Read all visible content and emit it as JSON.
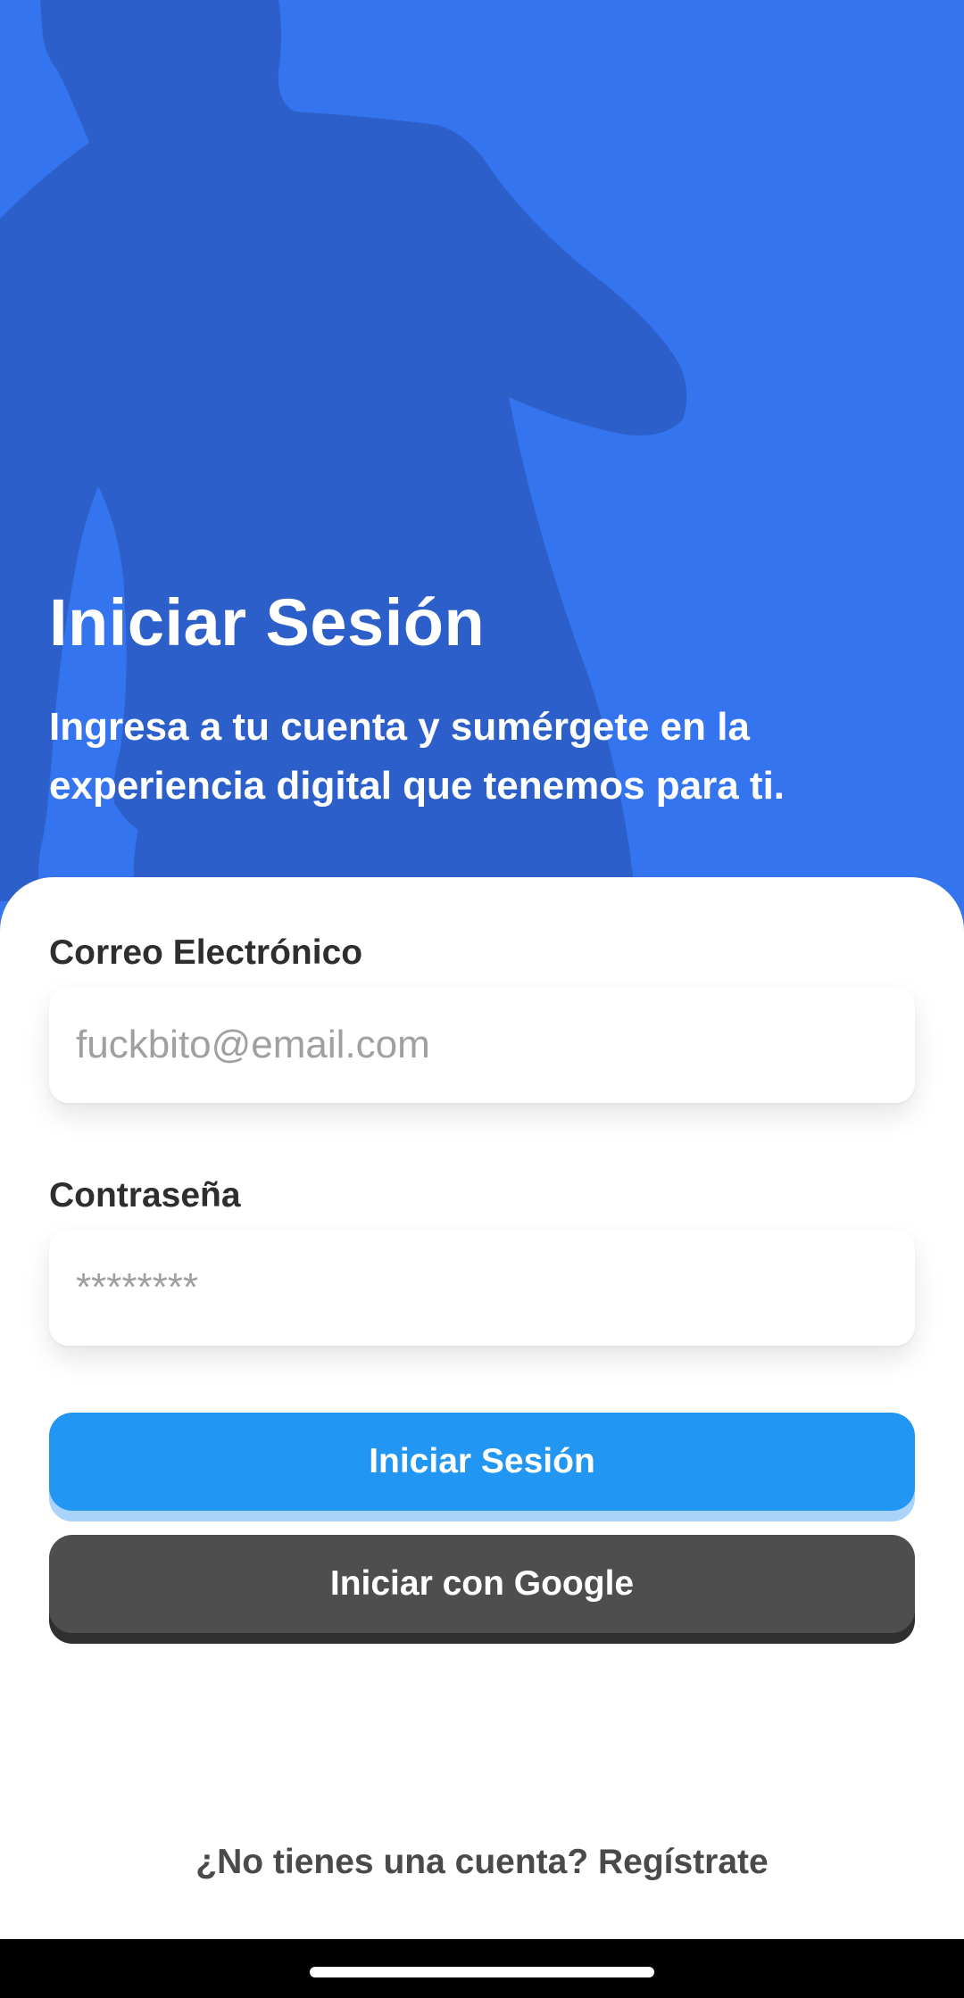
{
  "colors": {
    "hero_background": "#3574ef",
    "silhouette": "#2c5fc9",
    "primary_button": "#2196f3",
    "secondary_button": "#4e4e4e"
  },
  "hero": {
    "title": "Iniciar Sesión",
    "subtitle": "Ingresa a tu cuenta y sumérgete en la experiencia digital que tenemos para ti."
  },
  "form": {
    "email_label": "Correo Electrónico",
    "email_placeholder": "fuckbito@email.com",
    "password_label": "Contraseña",
    "password_placeholder": "********"
  },
  "buttons": {
    "login_label": "Iniciar Sesión",
    "google_label": "Iniciar con Google"
  },
  "footer": {
    "signup_text": "¿No tienes una cuenta? Regístrate"
  },
  "system": {
    "home_indicator_icon": "home-indicator"
  }
}
